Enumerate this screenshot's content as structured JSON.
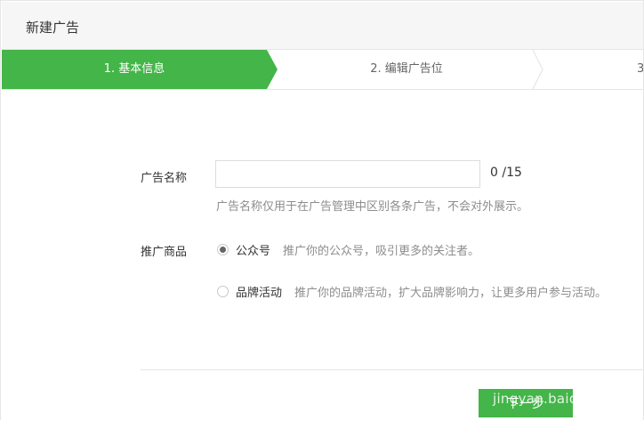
{
  "header": {
    "title": "新建广告"
  },
  "steps": [
    {
      "label": "1. 基本信息",
      "active": true
    },
    {
      "label": "2. 编辑广告位",
      "active": false
    },
    {
      "label": "3",
      "active": false
    }
  ],
  "form": {
    "name_label": "广告名称",
    "name_value": "",
    "name_placeholder": "",
    "counter": "0 /15",
    "name_hint": "广告名称仅用于在广告管理中区别各条广告，不会对外展示。",
    "product_label": "推广商品",
    "options": [
      {
        "label": "公众号",
        "desc": "推广你的公众号，吸引更多的关注者。",
        "selected": true
      },
      {
        "label": "品牌活动",
        "desc": "推广你的品牌活动，扩大品牌影响力，让更多用户参与活动。",
        "selected": false
      }
    ]
  },
  "footer": {
    "next_label": "下一步"
  },
  "watermark": {
    "text": "jingyan.baidu"
  },
  "colors": {
    "accent": "#44b549",
    "header_bg": "#f6f6f6",
    "hint": "#8d8d8d"
  }
}
